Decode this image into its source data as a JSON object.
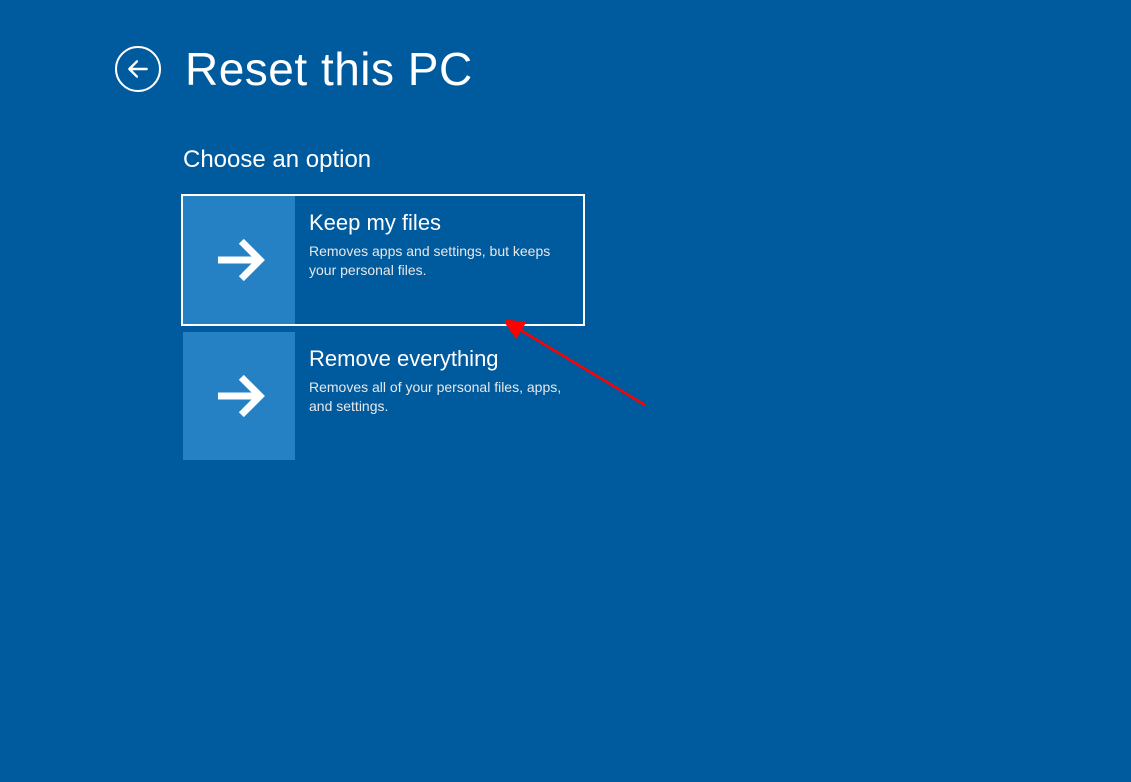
{
  "page": {
    "title": "Reset this PC",
    "subtitle": "Choose an option"
  },
  "options": [
    {
      "title": "Keep my files",
      "description": "Removes apps and settings, but keeps your personal files.",
      "selected": true
    },
    {
      "title": "Remove everything",
      "description": "Removes all of your personal files, apps, and settings.",
      "selected": false
    }
  ],
  "colors": {
    "background": "#005a9e",
    "tile": "#2581c4",
    "text": "#ffffff",
    "annotation": "#ff0000"
  }
}
